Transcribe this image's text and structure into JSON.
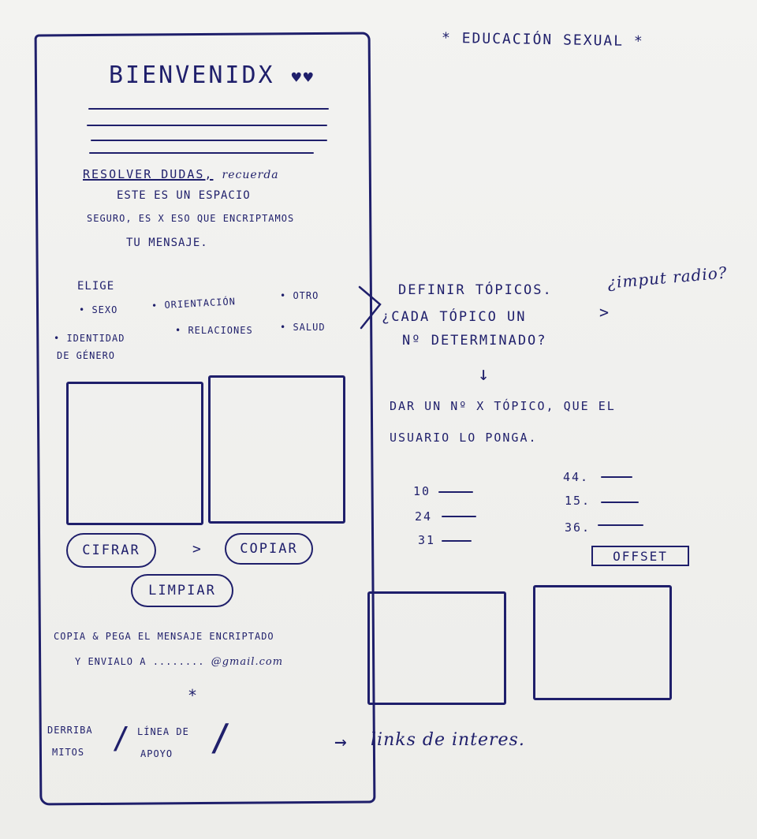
{
  "header": {
    "title": "* EDUCACIÓN SEXUAL *"
  },
  "mockup": {
    "welcome": "BIENVENIDX",
    "hearts": "♥♥",
    "intro": {
      "part1": "RESOLVER DUDAS,",
      "part2": "recuerda",
      "line2": "ESTE ES UN ESPACIO",
      "line3": "SEGURO, ES X ESO QUE ENCRIPTAMOS",
      "line4": "TU MENSAJE."
    },
    "choose_label": "ELIGE",
    "topics_row1": [
      "• SEXO",
      "• ORIENTACIÓN",
      "• OTRO"
    ],
    "topics_row2": [
      "• IDENTIDAD",
      "• RELACIONES",
      "• SALUD"
    ],
    "topics_row3": "DE GÉNERO",
    "buttons": {
      "encrypt": "CIFRAR",
      "arrow": ">",
      "copy": "COPIAR",
      "clear": "LIMPIAR"
    },
    "instructions": {
      "line1": "COPIA & PEGA EL MENSAJE ENCRIPTADO",
      "line2a": "Y ENVIALO A ........",
      "line2b": "@gmail.com"
    },
    "star": "*",
    "footer": {
      "myths_l1": "DERRIBA",
      "myths_l2": "MITOS",
      "sep": "/",
      "help_l1": "LÍNEA DE",
      "help_l2": "APOYO",
      "sep2": "/"
    }
  },
  "notes": {
    "define_topics": "DEFINIR TÓPICOS.",
    "each_topic_q": "¿CADA TÓPICO UN",
    "each_topic_q2": "Nº DETERMINADO?",
    "input_radio": "¿imput radio?",
    "down_arrow": "↓",
    "give_number": "DAR UN Nº X TÓPICO, QUE EL",
    "user_sets": "USUARIO LO PONGA.",
    "numbers_left": [
      "10",
      "24",
      "31"
    ],
    "numbers_right": [
      "44.",
      "15.",
      "36."
    ],
    "offset_button": "OFFSET",
    "links_arrow": "→",
    "links": "links de interes."
  }
}
